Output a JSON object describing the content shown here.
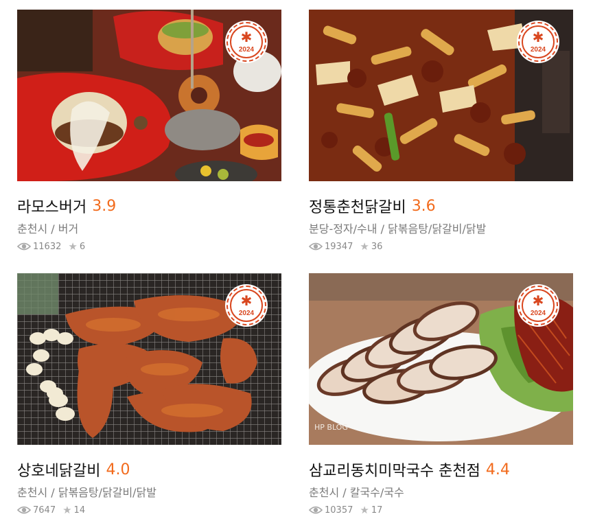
{
  "badge_year": "2024",
  "cards": [
    {
      "name": "라모스버거",
      "rating": "3.9",
      "region": "춘천시",
      "category": "버거",
      "views": "11632",
      "favorites": "6",
      "photo": "burger"
    },
    {
      "name": "정통춘천닭갈비",
      "rating": "3.6",
      "region": "분당-정자/수내",
      "category": "닭볶음탕/닭갈비/닭발",
      "views": "19347",
      "favorites": "36",
      "photo": "dakgalbi"
    },
    {
      "name": "상호네닭갈비",
      "rating": "4.0",
      "region": "춘천시",
      "category": "닭볶음탕/닭갈비/닭발",
      "views": "7647",
      "favorites": "14",
      "photo": "grill"
    },
    {
      "name": "삼교리동치미막국수 춘천점",
      "rating": "4.4",
      "region": "춘천시",
      "category": "칼국수/국수",
      "views": "10357",
      "favorites": "17",
      "photo": "pork"
    }
  ],
  "separator": " / ",
  "photo_watermark": "HP BLOG",
  "colors": {
    "rating": "#f26b1d",
    "badge": "#d9471f"
  }
}
